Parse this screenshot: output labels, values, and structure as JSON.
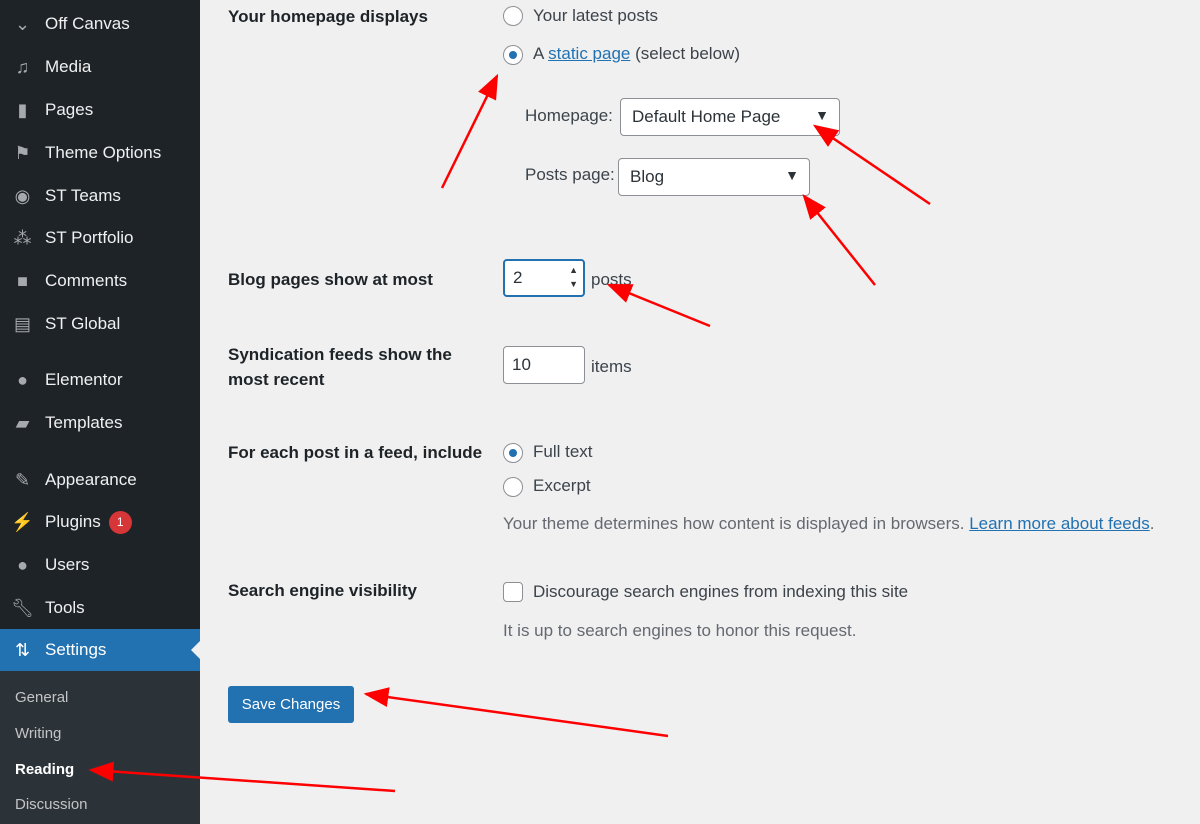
{
  "sidebar": {
    "items": [
      {
        "label": "Off Canvas",
        "icon": "chevron-down-icon"
      },
      {
        "label": "Media",
        "icon": "media-icon"
      },
      {
        "label": "Pages",
        "icon": "pages-icon"
      },
      {
        "label": "Theme Options",
        "icon": "mortarboard-icon"
      },
      {
        "label": "ST Teams",
        "icon": "user-circle-icon"
      },
      {
        "label": "ST Portfolio",
        "icon": "circles-icon"
      },
      {
        "label": "Comments",
        "icon": "comment-icon"
      },
      {
        "label": "ST Global",
        "icon": "document-icon"
      },
      {
        "label": "Elementor",
        "icon": "elementor-icon"
      },
      {
        "label": "Templates",
        "icon": "folder-icon"
      },
      {
        "label": "Appearance",
        "icon": "paintbrush-icon"
      },
      {
        "label": "Plugins",
        "icon": "plug-icon",
        "badge": "1"
      },
      {
        "label": "Users",
        "icon": "user-icon"
      },
      {
        "label": "Tools",
        "icon": "wrench-icon"
      },
      {
        "label": "Settings",
        "icon": "settings-icon",
        "active": true
      }
    ],
    "submenu": [
      "General",
      "Writing",
      "Reading",
      "Discussion"
    ],
    "current": "Reading"
  },
  "form": {
    "homepage_displays": {
      "label": "Your homepage displays",
      "opt1": "Your latest posts",
      "opt2_pre": "A",
      "opt2_link": "static page",
      "opt2_post": "(select below)",
      "selected": "static page",
      "homepage_label": "Homepage:",
      "homepage_value": "Default Home Page",
      "posts_label": "Posts page:",
      "posts_value": "Blog"
    },
    "blog_pages": {
      "label": "Blog pages show at most",
      "value": "2",
      "unit": "posts"
    },
    "syndication": {
      "label1": "Syndication feeds show the",
      "label2": "most recent",
      "value": "10",
      "unit": "items"
    },
    "feed_include": {
      "label": "For each post in a feed, include",
      "opt1": "Full text",
      "opt2": "Excerpt",
      "selected": "Full text",
      "desc": "Your theme determines how content is displayed in browsers.",
      "link": "Learn more about feeds",
      "link_suffix": "."
    },
    "search": {
      "label": "Search engine visibility",
      "checkbox": "Discourage search engines from indexing this site",
      "checked": false,
      "desc": "It is up to search engines to honor this request."
    },
    "save": "Save Changes"
  },
  "colors": {
    "accent": "#2271b1",
    "annotation": "#ff0000",
    "sidebar": "#1d2327"
  }
}
